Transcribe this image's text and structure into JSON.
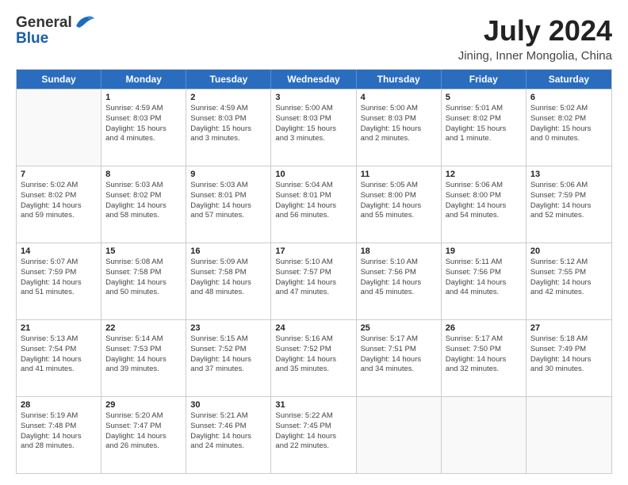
{
  "header": {
    "logo_general": "General",
    "logo_blue": "Blue",
    "title": "July 2024",
    "subtitle": "Jining, Inner Mongolia, China"
  },
  "weekdays": [
    "Sunday",
    "Monday",
    "Tuesday",
    "Wednesday",
    "Thursday",
    "Friday",
    "Saturday"
  ],
  "weeks": [
    [
      {
        "day": "",
        "info": ""
      },
      {
        "day": "1",
        "info": "Sunrise: 4:59 AM\nSunset: 8:03 PM\nDaylight: 15 hours\nand 4 minutes."
      },
      {
        "day": "2",
        "info": "Sunrise: 4:59 AM\nSunset: 8:03 PM\nDaylight: 15 hours\nand 3 minutes."
      },
      {
        "day": "3",
        "info": "Sunrise: 5:00 AM\nSunset: 8:03 PM\nDaylight: 15 hours\nand 3 minutes."
      },
      {
        "day": "4",
        "info": "Sunrise: 5:00 AM\nSunset: 8:03 PM\nDaylight: 15 hours\nand 2 minutes."
      },
      {
        "day": "5",
        "info": "Sunrise: 5:01 AM\nSunset: 8:02 PM\nDaylight: 15 hours\nand 1 minute."
      },
      {
        "day": "6",
        "info": "Sunrise: 5:02 AM\nSunset: 8:02 PM\nDaylight: 15 hours\nand 0 minutes."
      }
    ],
    [
      {
        "day": "7",
        "info": "Sunrise: 5:02 AM\nSunset: 8:02 PM\nDaylight: 14 hours\nand 59 minutes."
      },
      {
        "day": "8",
        "info": "Sunrise: 5:03 AM\nSunset: 8:02 PM\nDaylight: 14 hours\nand 58 minutes."
      },
      {
        "day": "9",
        "info": "Sunrise: 5:03 AM\nSunset: 8:01 PM\nDaylight: 14 hours\nand 57 minutes."
      },
      {
        "day": "10",
        "info": "Sunrise: 5:04 AM\nSunset: 8:01 PM\nDaylight: 14 hours\nand 56 minutes."
      },
      {
        "day": "11",
        "info": "Sunrise: 5:05 AM\nSunset: 8:00 PM\nDaylight: 14 hours\nand 55 minutes."
      },
      {
        "day": "12",
        "info": "Sunrise: 5:06 AM\nSunset: 8:00 PM\nDaylight: 14 hours\nand 54 minutes."
      },
      {
        "day": "13",
        "info": "Sunrise: 5:06 AM\nSunset: 7:59 PM\nDaylight: 14 hours\nand 52 minutes."
      }
    ],
    [
      {
        "day": "14",
        "info": "Sunrise: 5:07 AM\nSunset: 7:59 PM\nDaylight: 14 hours\nand 51 minutes."
      },
      {
        "day": "15",
        "info": "Sunrise: 5:08 AM\nSunset: 7:58 PM\nDaylight: 14 hours\nand 50 minutes."
      },
      {
        "day": "16",
        "info": "Sunrise: 5:09 AM\nSunset: 7:58 PM\nDaylight: 14 hours\nand 48 minutes."
      },
      {
        "day": "17",
        "info": "Sunrise: 5:10 AM\nSunset: 7:57 PM\nDaylight: 14 hours\nand 47 minutes."
      },
      {
        "day": "18",
        "info": "Sunrise: 5:10 AM\nSunset: 7:56 PM\nDaylight: 14 hours\nand 45 minutes."
      },
      {
        "day": "19",
        "info": "Sunrise: 5:11 AM\nSunset: 7:56 PM\nDaylight: 14 hours\nand 44 minutes."
      },
      {
        "day": "20",
        "info": "Sunrise: 5:12 AM\nSunset: 7:55 PM\nDaylight: 14 hours\nand 42 minutes."
      }
    ],
    [
      {
        "day": "21",
        "info": "Sunrise: 5:13 AM\nSunset: 7:54 PM\nDaylight: 14 hours\nand 41 minutes."
      },
      {
        "day": "22",
        "info": "Sunrise: 5:14 AM\nSunset: 7:53 PM\nDaylight: 14 hours\nand 39 minutes."
      },
      {
        "day": "23",
        "info": "Sunrise: 5:15 AM\nSunset: 7:52 PM\nDaylight: 14 hours\nand 37 minutes."
      },
      {
        "day": "24",
        "info": "Sunrise: 5:16 AM\nSunset: 7:52 PM\nDaylight: 14 hours\nand 35 minutes."
      },
      {
        "day": "25",
        "info": "Sunrise: 5:17 AM\nSunset: 7:51 PM\nDaylight: 14 hours\nand 34 minutes."
      },
      {
        "day": "26",
        "info": "Sunrise: 5:17 AM\nSunset: 7:50 PM\nDaylight: 14 hours\nand 32 minutes."
      },
      {
        "day": "27",
        "info": "Sunrise: 5:18 AM\nSunset: 7:49 PM\nDaylight: 14 hours\nand 30 minutes."
      }
    ],
    [
      {
        "day": "28",
        "info": "Sunrise: 5:19 AM\nSunset: 7:48 PM\nDaylight: 14 hours\nand 28 minutes."
      },
      {
        "day": "29",
        "info": "Sunrise: 5:20 AM\nSunset: 7:47 PM\nDaylight: 14 hours\nand 26 minutes."
      },
      {
        "day": "30",
        "info": "Sunrise: 5:21 AM\nSunset: 7:46 PM\nDaylight: 14 hours\nand 24 minutes."
      },
      {
        "day": "31",
        "info": "Sunrise: 5:22 AM\nSunset: 7:45 PM\nDaylight: 14 hours\nand 22 minutes."
      },
      {
        "day": "",
        "info": ""
      },
      {
        "day": "",
        "info": ""
      },
      {
        "day": "",
        "info": ""
      }
    ]
  ]
}
